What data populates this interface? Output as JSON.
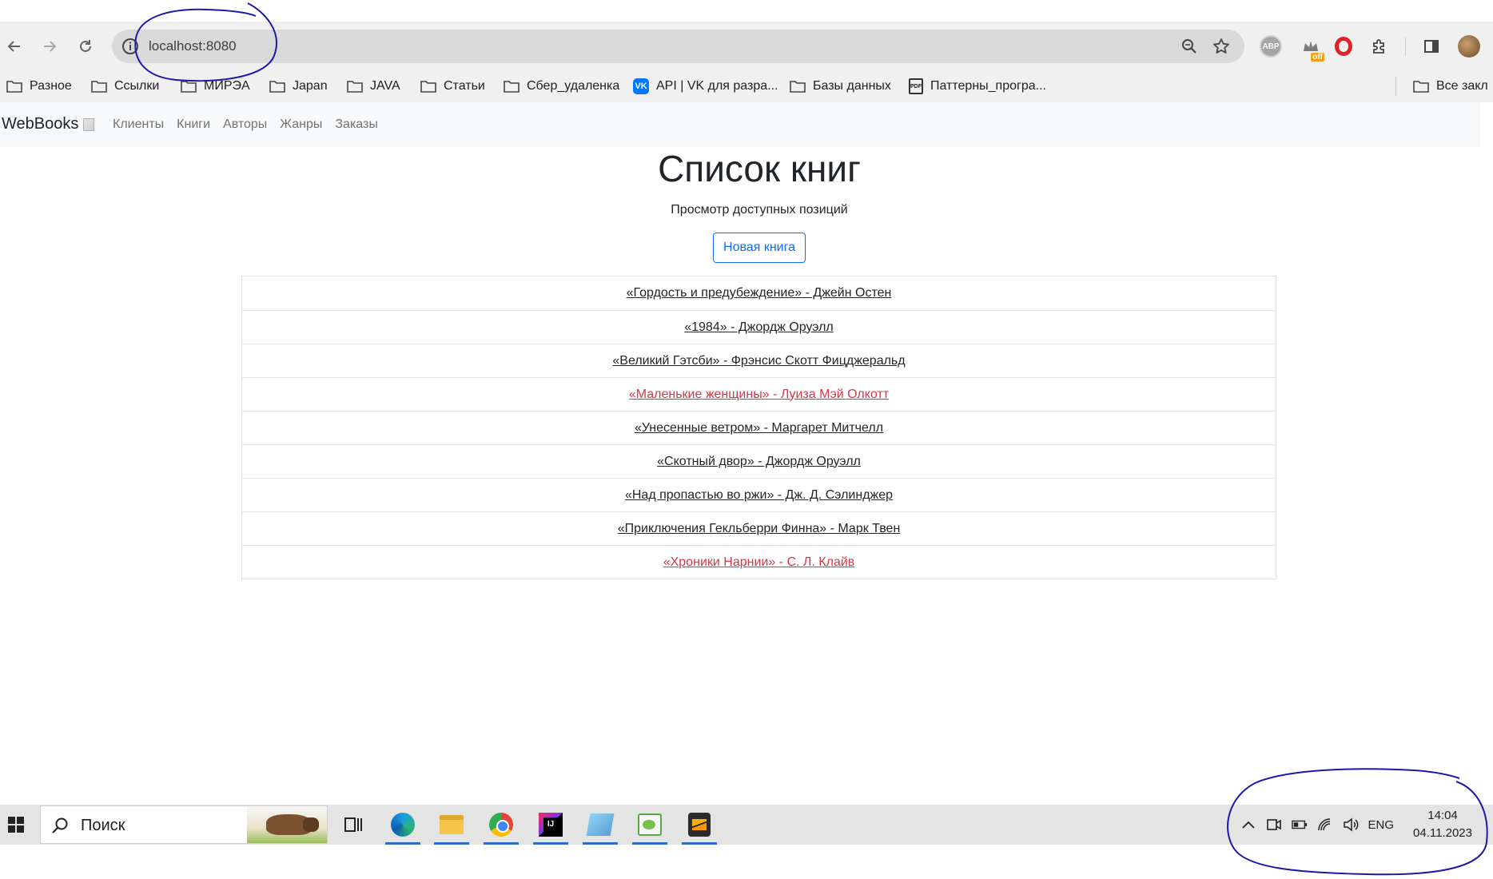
{
  "browser": {
    "address": "localhost:8080",
    "extensions": {
      "abp_label": "ABP",
      "off_badge": "off"
    }
  },
  "bookmarks": [
    {
      "label": "Разное",
      "icon": "folder-icon"
    },
    {
      "label": "Ссылки",
      "icon": "folder-icon"
    },
    {
      "label": "МИРЭА",
      "icon": "folder-icon"
    },
    {
      "label": "Japan",
      "icon": "folder-icon"
    },
    {
      "label": "JAVA",
      "icon": "folder-icon"
    },
    {
      "label": "Статьи",
      "icon": "folder-icon"
    },
    {
      "label": "Сбер_удаленка",
      "icon": "folder-icon"
    },
    {
      "label": "API | VK для разра...",
      "icon": "vk-icon"
    },
    {
      "label": "Базы данных",
      "icon": "folder-icon"
    },
    {
      "label": "Паттерны_програ...",
      "icon": "pdf-icon"
    },
    {
      "label": "Все закл",
      "icon": "folder-icon"
    }
  ],
  "navbar": {
    "brand": "WebBooks",
    "links": [
      "Клиенты",
      "Книги",
      "Авторы",
      "Жанры",
      "Заказы"
    ]
  },
  "main": {
    "title": "Список книг",
    "subtitle": "Просмотр доступных позиций",
    "new_book_button": "Новая книга",
    "books": [
      {
        "text": "«Гордость и предубеждение» - Джейн Остен",
        "highlight": false
      },
      {
        "text": "«1984» - Джордж Оруэлл",
        "highlight": false
      },
      {
        "text": "«Великий Гэтсби» - Фрэнсис Скотт Фицджеральд",
        "highlight": false
      },
      {
        "text": "«Маленькие женщины» - Луиза Мэй Олкотт",
        "highlight": true
      },
      {
        "text": "«Унесенные ветром» - Маргарет Митчелл",
        "highlight": false
      },
      {
        "text": "«Скотный двор» - Джордж Оруэлл",
        "highlight": false
      },
      {
        "text": "«Над пропастью во ржи» - Дж. Д. Сэлинджер",
        "highlight": false
      },
      {
        "text": "«Приключения Гекльберри Финна» - Марк Твен",
        "highlight": false
      },
      {
        "text": "«Хроники Нарнии» - С. Л. Клайв",
        "highlight": true
      }
    ],
    "highlight_color": "#dc3545"
  },
  "taskbar": {
    "search_placeholder": "Поиск",
    "language": "ENG",
    "time": "14:04",
    "date": "04.11.2023"
  },
  "annotations": {
    "color": "#1a1aa8"
  }
}
